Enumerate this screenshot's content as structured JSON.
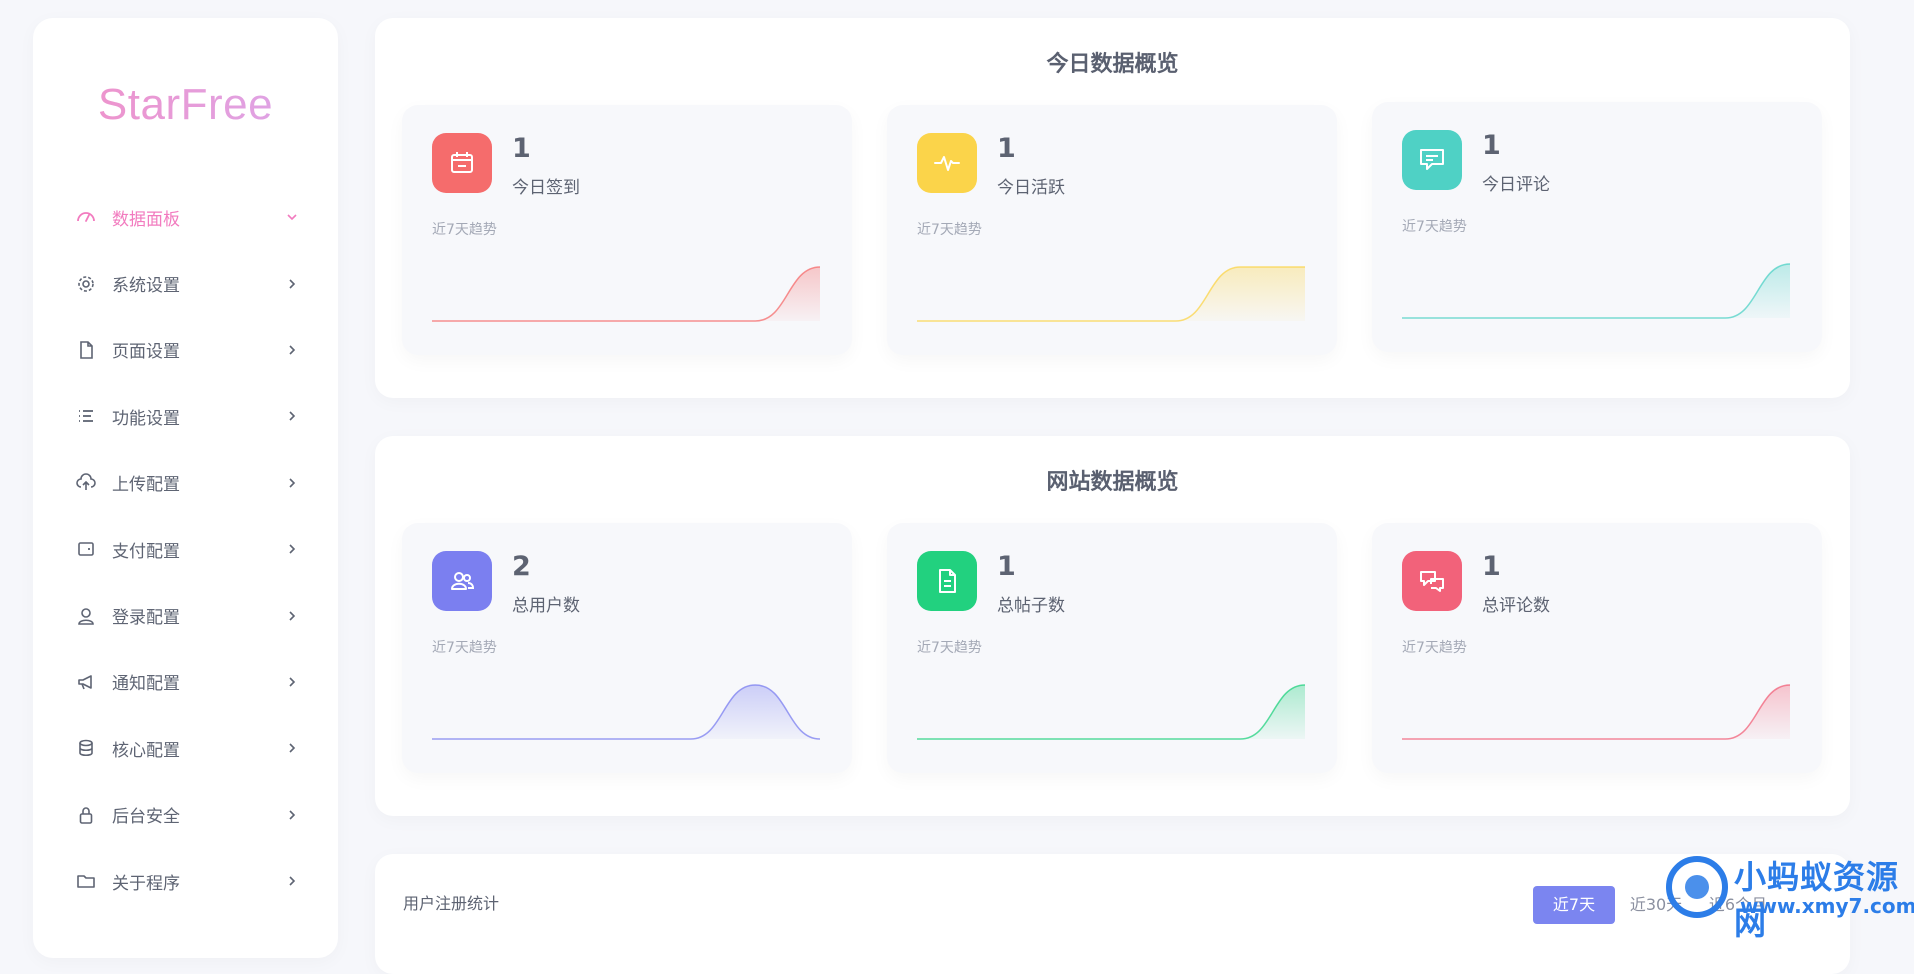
{
  "app": {
    "logo": "StarFree"
  },
  "sidebar": {
    "items": [
      {
        "label": "数据面板",
        "icon": "dashboard-gauge-icon",
        "active": true
      },
      {
        "label": "系统设置",
        "icon": "gear-icon"
      },
      {
        "label": "页面设置",
        "icon": "document-icon"
      },
      {
        "label": "功能设置",
        "icon": "list-icon"
      },
      {
        "label": "上传配置",
        "icon": "cloud-upload-icon"
      },
      {
        "label": "支付配置",
        "icon": "wallet-icon"
      },
      {
        "label": "登录配置",
        "icon": "user-icon"
      },
      {
        "label": "通知配置",
        "icon": "megaphone-icon"
      },
      {
        "label": "核心配置",
        "icon": "database-icon"
      },
      {
        "label": "后台安全",
        "icon": "lock-icon"
      },
      {
        "label": "关于程序",
        "icon": "folder-icon"
      }
    ]
  },
  "today": {
    "title": "今日数据概览",
    "cards": [
      {
        "value": "1",
        "label": "今日签到",
        "trend": "近7天趋势",
        "icon": "calendar-icon",
        "color": "#f56c6c",
        "series": [
          0,
          0,
          0,
          0,
          0,
          0,
          1
        ]
      },
      {
        "value": "1",
        "label": "今日活跃",
        "trend": "近7天趋势",
        "icon": "activity-pulse-icon",
        "color": "#fbd44a",
        "series": [
          0,
          0,
          0,
          0,
          0,
          1,
          1
        ]
      },
      {
        "value": "1",
        "label": "今日评论",
        "trend": "近7天趋势",
        "icon": "comment-icon",
        "color": "#4fd1c5",
        "series": [
          0,
          0,
          0,
          0,
          0,
          0,
          1
        ]
      }
    ]
  },
  "site": {
    "title": "网站数据概览",
    "cards": [
      {
        "value": "2",
        "label": "总用户数",
        "trend": "近7天趋势",
        "icon": "users-icon",
        "color": "#7b7ff0",
        "series": [
          0,
          0,
          0,
          0,
          0,
          1,
          0
        ]
      },
      {
        "value": "1",
        "label": "总帖子数",
        "trend": "近7天趋势",
        "icon": "post-document-icon",
        "color": "#22d17f",
        "series": [
          0,
          0,
          0,
          0,
          0,
          0,
          1
        ]
      },
      {
        "value": "1",
        "label": "总评论数",
        "trend": "近7天趋势",
        "icon": "comments-icon",
        "color": "#f2627a",
        "series": [
          0,
          0,
          0,
          0,
          0,
          0,
          1
        ]
      }
    ]
  },
  "registration": {
    "title": "用户注册统计",
    "tabs": [
      {
        "label": "近7天",
        "active": true
      },
      {
        "label": "近30天"
      },
      {
        "label": "近6个月"
      }
    ]
  },
  "watermark": {
    "line1": "小蚂蚁资源网",
    "line2": "www.xmy7.com"
  },
  "colors": {
    "accent": "#7b85f0",
    "active_menu": "#f27bbf",
    "logo_gradient": [
      "#f28fc5",
      "#dba8ec"
    ]
  }
}
